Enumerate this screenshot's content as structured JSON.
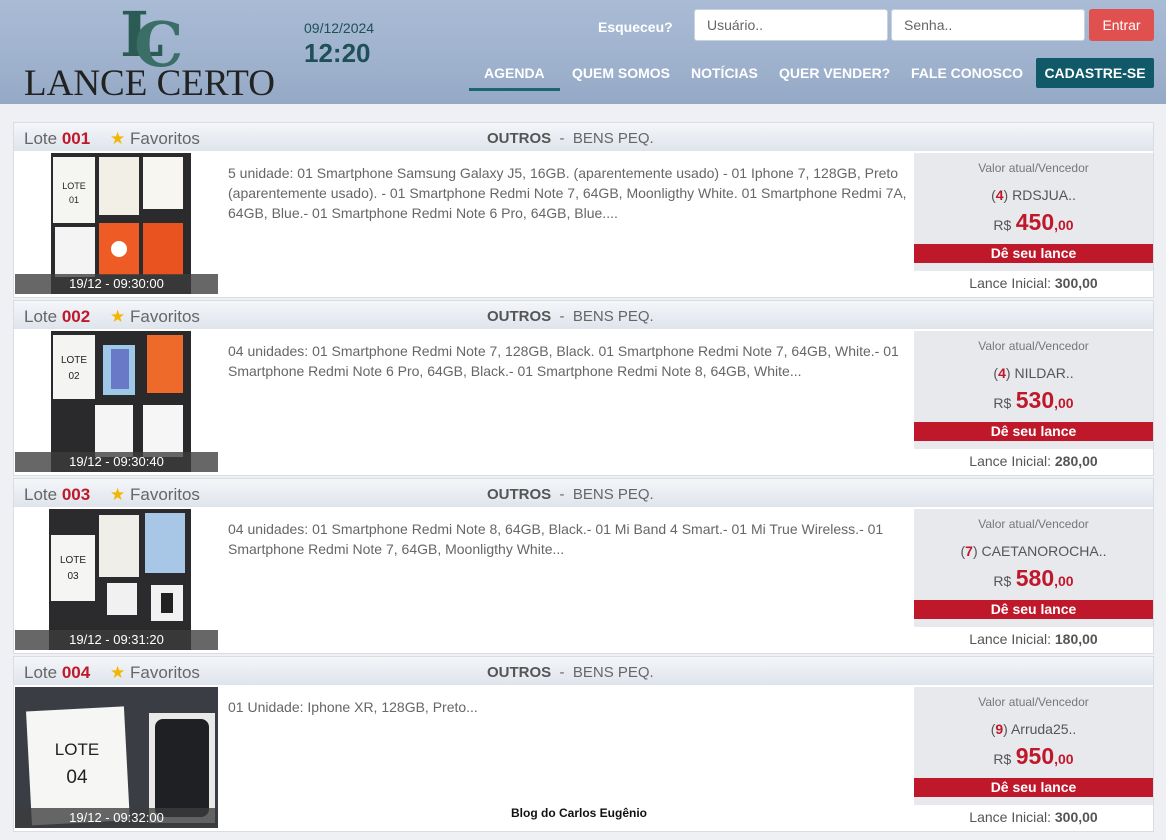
{
  "header": {
    "logo_text": "LANCE CERTO",
    "logo_mono": "LC",
    "date": "09/12/2024",
    "time": "12:20",
    "forgot": "Esqueceu?",
    "user_placeholder": "Usuário..",
    "pass_placeholder": "Senha..",
    "enter": "Entrar",
    "nav": [
      "AGENDA",
      "QUEM SOMOS",
      "NOTÍCIAS",
      "QUER VENDER?",
      "FALE CONOSCO"
    ],
    "cadastre": "CADASTRE-SE"
  },
  "labels": {
    "lot_prefix": "Lote",
    "favorites": "Favoritos",
    "value_label": "Valor atual/Vencedor",
    "currency": "R$",
    "bid_button": "Dê seu lance",
    "initial_label": "Lance Inicial:",
    "category": "OUTROS",
    "category_sep": "-",
    "subcategory": "BENS PEQ."
  },
  "lots": [
    {
      "number": "001",
      "timestamp": "19/12 - 09:30:00",
      "description": "5 unidade: 01 Smartphone Samsung Galaxy J5, 16GB. (aparentemente usado) - 01 Iphone 7, 128GB, Preto (aparentemente usado). - 01 Smartphone Redmi Note 7, 64GB, Moonligthy White. 01 Smartphone Redmi 7A, 64GB, Blue.- 01 Smartphone Redmi Note 6 Pro, 64GB, Blue....",
      "bids": "4",
      "winner": "RDSJUA..",
      "price_int": "450",
      "price_dec": ",00",
      "initial": "300,00"
    },
    {
      "number": "002",
      "timestamp": "19/12 - 09:30:40",
      "description": "04 unidades: 01 Smartphone Redmi Note 7, 128GB, Black. 01 Smartphone Redmi Note 7, 64GB, White.- 01 Smartphone Redmi Note 6 Pro, 64GB, Black.- 01 Smartphone Redmi Note 8, 64GB, White...",
      "bids": "4",
      "winner": "NILDAR..",
      "price_int": "530",
      "price_dec": ",00",
      "initial": "280,00"
    },
    {
      "number": "003",
      "timestamp": "19/12 - 09:31:20",
      "description": "04 unidades: 01 Smartphone Redmi Note 8, 64GB, Black.- 01 Mi Band 4 Smart.- 01 Mi True Wireless.- 01 Smartphone Redmi Note 7, 64GB, Moonligthy White...",
      "bids": "7",
      "winner": "CAETANOROCHA..",
      "price_int": "580",
      "price_dec": ",00",
      "initial": "180,00"
    },
    {
      "number": "004",
      "timestamp": "19/12 - 09:32:00",
      "description": "01 Unidade: Iphone XR, 128GB, Preto...",
      "bids": "9",
      "winner": "Arruda25..",
      "price_int": "950",
      "price_dec": ",00",
      "initial": "300,00"
    }
  ],
  "thumb_text": {
    "lote1": "LOTE",
    "lote1_n": "01",
    "lote2": "LOTE",
    "lote2_n": "02",
    "lote3": "LOTE",
    "lote3_n": "03",
    "lote4": "LOTE",
    "lote4_n": "04"
  },
  "watermark": "Blog do Carlos Eugênio"
}
